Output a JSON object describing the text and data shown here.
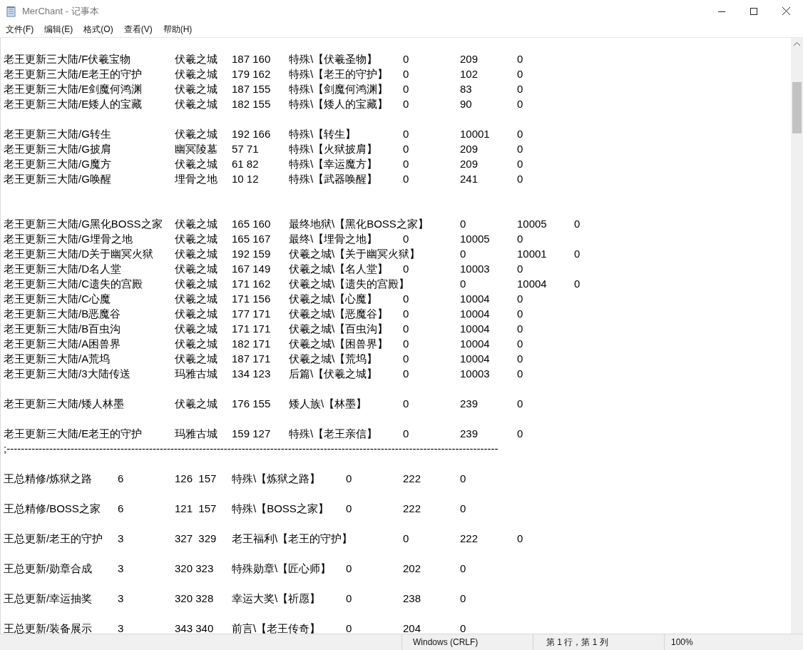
{
  "window": {
    "title": "MerChant - 记事本"
  },
  "menu": [
    "文件(F)",
    "编辑(E)",
    "格式(O)",
    "查看(V)",
    "帮助(H)"
  ],
  "document": {
    "text": "老王更新三大陆/F伏羲宝物\t伏羲之城\t187 160\t特殊\\【伏羲圣物】\t0\t209\t0\n老王更新三大陆/E老王的守护\t伏羲之城\t179 162\t特殊\\【老王的守护】\t0\t102\t0\n老王更新三大陆/E剑魔何鸿渊\t伏羲之城\t187 155\t特殊\\【剑魔何鸿渊】\t0\t83\t0\n老王更新三大陆/E矮人的宝藏\t伏羲之城\t182 155\t特殊\\【矮人的宝藏】\t0\t90\t0\n\n老王更新三大陆/G转生\t\t伏羲之城\t192 166\t特殊\\【转生】\t0\t10001\t0\n老王更新三大陆/G披肩\t\t幽冥陵墓\t57 71\t特殊\\【火狱披肩】\t0\t209\t0\n老王更新三大陆/G魔方\t\t伏羲之城\t61 82\t特殊\\【幸运魔方】\t0\t209\t0\n老王更新三大陆/G唤醒\t\t埋骨之地\t10 12\t特殊\\【武器唤醒】\t0\t241\t0\n\n\n老王更新三大陆/G黑化BOSS之家\t伏羲之城\t165 160\t最终地狱\\【黑化BOSS之家】\t0\t10005\t0\n老王更新三大陆/G埋骨之地\t伏羲之城\t165 167\t最终\\【埋骨之地】\t0\t10005\t0\n老王更新三大陆/D关于幽冥火狱\t伏羲之城\t192 159\t伏羲之城\\【关于幽冥火狱】\t0\t10001\t0\n老王更新三大陆/D名人堂\t伏羲之城\t167 149\t伏羲之城\\【名人堂】\t0\t10003\t0\n老王更新三大陆/C遗失的宫殿\t伏羲之城\t171 162\t伏羲之城\\【遗失的宫殿】\t0\t10004\t0\n老王更新三大陆/C心魔\t\t伏羲之城\t171 156\t伏羲之城\\【心魔】\t0\t10004\t0\n老王更新三大陆/B恶魔谷\t伏羲之城\t177 171\t伏羲之城\\【恶魔谷】\t0\t10004\t0\n老王更新三大陆/B百虫沟\t伏羲之城\t171 171\t伏羲之城\\【百虫沟】\t0\t10004\t0\n老王更新三大陆/A困兽界\t伏羲之城\t182 171\t伏羲之城\\【困兽界】\t0\t10004\t0\n老王更新三大陆/A荒坞\t\t伏羲之城\t187 171\t伏羲之城\\【荒坞】\t0\t10004\t0\n老王更新三大陆/3大陆传送\t玛雅古城\t134 123\t后篇\\【伏羲之城】\t0\t10003\t0\n\n老王更新三大陆/矮人林墨\t伏羲之城\t176 155\t矮人族\\【林墨】\t0\t239\t0\n\n老王更新三大陆/E老王的守护\t玛雅古城\t159 127\t特殊\\【老王亲信】\t0\t239\t0\n;------------------------------------------------------------------------------------------------------------------------------------------\n\n王总精修/炼狱之路\t6\t126  157\t特殊\\【炼狱之路】\t0\t222\t0\n\n王总精修/BOSS之家\t6\t121  157\t特殊\\【BOSS之家】\t0\t222\t0\n\n王总更新/老王的守护\t3\t327  329\t老王福利\\【老王的守护】\t0\t222\t0\n\n王总更新/勋章合成\t3\t320 323\t特殊勋章\\【匠心师】\t0\t202\t0\n\n王总更新/幸运抽奖\t3\t320 328\t幸运大奖\\【祈愿】\t0\t238\t0\n\n王总更新/装备展示\t3\t343 340\t前言\\【老王传奇】\t0\t204\t0"
  },
  "status_bar": {
    "line_ending": "Windows (CRLF)",
    "position": "第 1 行，第 1 列",
    "zoom": "100%"
  }
}
